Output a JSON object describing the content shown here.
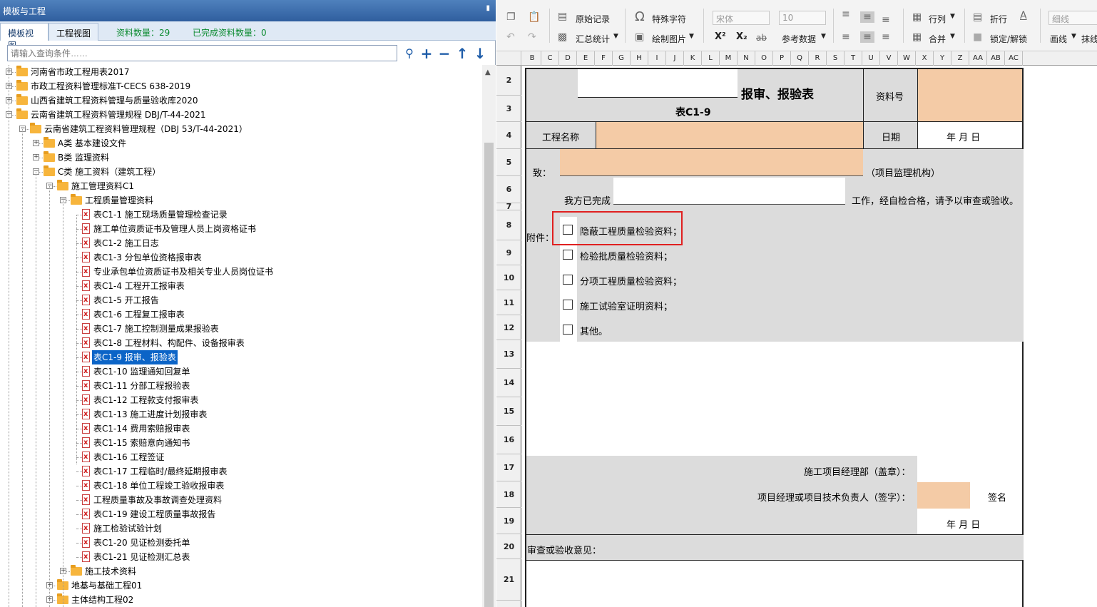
{
  "panel": {
    "title": "模板与工程",
    "pin_icon": "pin-icon",
    "tabs": [
      "模板视图",
      "工程视图"
    ],
    "data_count_label": "资料数量：29",
    "completed_count_label": "已完成资料数量：0",
    "search_placeholder": "请输入查询条件……",
    "tools": [
      "search-icon",
      "add-icon",
      "minus-icon",
      "up-arrow-icon",
      "down-arrow-icon"
    ]
  },
  "tree": [
    {
      "label": "河南省市政工程用表2017",
      "type": "folder",
      "expanded": false
    },
    {
      "label": "市政工程资料管理标准T-CECS 638-2019",
      "type": "folder",
      "expanded": false
    },
    {
      "label": "山西省建筑工程资料管理与质量验收库2020",
      "type": "folder",
      "expanded": false
    },
    {
      "label": "云南省建筑工程资料管理规程 DBJ/T-44-2021",
      "type": "folder",
      "expanded": true
    },
    {
      "label": "云南省建筑工程资料管理规程（DBJ 53/T-44-2021）",
      "type": "folder",
      "expanded": true
    },
    {
      "label": "A类 基本建设文件",
      "type": "folder",
      "expanded": false
    },
    {
      "label": "B类 监理资料",
      "type": "folder",
      "expanded": false
    },
    {
      "label": "C类 施工资料（建筑工程）",
      "type": "folder",
      "expanded": true
    },
    {
      "label": "施工管理资料C1",
      "type": "folder",
      "expanded": true
    },
    {
      "label": "工程质量管理资料",
      "type": "folder",
      "expanded": true
    },
    {
      "label": "表C1-1 施工现场质量管理检查记录",
      "type": "file"
    },
    {
      "label": "施工单位资质证书及管理人员上岗资格证书",
      "type": "file"
    },
    {
      "label": "表C1-2 施工日志",
      "type": "file"
    },
    {
      "label": "表C1-3 分包单位资格报审表",
      "type": "file"
    },
    {
      "label": "专业承包单位资质证书及相关专业人员岗位证书",
      "type": "file"
    },
    {
      "label": "表C1-4 工程开工报审表",
      "type": "file"
    },
    {
      "label": "表C1-5 开工报告",
      "type": "file"
    },
    {
      "label": "表C1-6 工程复工报审表",
      "type": "file"
    },
    {
      "label": "表C1-7 施工控制测量成果报验表",
      "type": "file"
    },
    {
      "label": "表C1-8 工程材料、构配件、设备报审表",
      "type": "file"
    },
    {
      "label": "表C1-9 报审、报验表",
      "type": "file",
      "selected": true
    },
    {
      "label": "表C1-10 监理通知回复单",
      "type": "file"
    },
    {
      "label": "表C1-11 分部工程报验表",
      "type": "file"
    },
    {
      "label": "表C1-12 工程款支付报审表",
      "type": "file"
    },
    {
      "label": "表C1-13 施工进度计划报审表",
      "type": "file"
    },
    {
      "label": "表C1-14 费用索赔报审表",
      "type": "file"
    },
    {
      "label": "表C1-15 索赔意向通知书",
      "type": "file"
    },
    {
      "label": "表C1-16 工程签证",
      "type": "file"
    },
    {
      "label": "表C1-17 工程临时/最终延期报审表",
      "type": "file"
    },
    {
      "label": "表C1-18 单位工程竣工验收报审表",
      "type": "file"
    },
    {
      "label": "工程质量事故及事故调查处理资料",
      "type": "file"
    },
    {
      "label": "表C1-19 建设工程质量事故报告",
      "type": "file"
    },
    {
      "label": "施工检验试验计划",
      "type": "file"
    },
    {
      "label": "表C1-20 见证检测委托单",
      "type": "file"
    },
    {
      "label": "表C1-21 见证检测汇总表",
      "type": "file"
    },
    {
      "label": "施工技术资料",
      "type": "folder",
      "expanded": false
    },
    {
      "label": "地基与基础工程01",
      "type": "folder",
      "expanded": false
    },
    {
      "label": "主体结构工程02",
      "type": "folder",
      "expanded": false
    }
  ],
  "toolbar": {
    "original_record": "原始记录",
    "summary_stats": "汇总统计",
    "special_char": "特殊字符",
    "draw_image": "绘制图片",
    "font_name": "宋体",
    "font_size": "10",
    "superscript": "X²",
    "subscript": "X₂",
    "strike": "ab",
    "ref_data": "参考数据",
    "row_col": "行列",
    "merge": "合并",
    "wrap": "折行",
    "lock_unlock": "锁定/解锁",
    "line_style": "细线",
    "draw_line": "画线",
    "more": "抹线"
  },
  "columns": [
    "B",
    "C",
    "D",
    "E",
    "F",
    "G",
    "H",
    "I",
    "J",
    "K",
    "L",
    "M",
    "N",
    "O",
    "P",
    "Q",
    "R",
    "S",
    "T",
    "U",
    "V",
    "W",
    "X",
    "Y",
    "Z",
    "AA",
    "AB",
    "AC"
  ],
  "rows": [
    "2",
    "3",
    "4",
    "5",
    "6",
    "7",
    "8",
    "9",
    "10",
    "11",
    "12",
    "13",
    "14",
    "15",
    "16",
    "17",
    "18",
    "19",
    "20",
    "21"
  ],
  "form": {
    "title": "报审、报验表",
    "table_no": "表C1-9",
    "doc_no_label": "资料号",
    "project_name_label": "工程名称",
    "date_label": "日期",
    "date_value": "年  月  日",
    "to_label": "致：",
    "to_suffix": "（项目监理机构）",
    "completed_label": "我方已完成",
    "completed_suffix": "工作，经自检合格，请予以审查或验收。",
    "attachment_label": "附件：",
    "attachments": [
      "隐蔽工程质量检验资料；",
      "检验批质量检验资料；",
      "分项工程质量检验资料；",
      "施工试验室证明资料；",
      "其他。"
    ],
    "pm_dept_label": "施工项目经理部（盖章）：",
    "pm_sign_label": "项目经理或项目技术负责人（签字）：",
    "sign_label": "签名",
    "sign_date": "年  月  日",
    "review_label": "审查或验收意见："
  }
}
